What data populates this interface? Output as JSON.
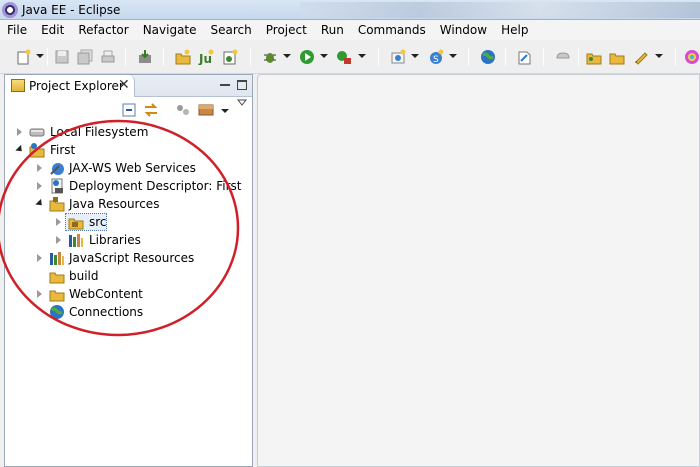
{
  "window": {
    "title": "Java EE - Eclipse"
  },
  "menubar": [
    "File",
    "Edit",
    "Refactor",
    "Navigate",
    "Search",
    "Project",
    "Run",
    "Commands",
    "Window",
    "Help"
  ],
  "toolbar": {
    "icons": [
      "new-icon",
      "save-icon",
      "save-all-icon",
      "print-icon",
      "import-icon",
      "new-project-icon",
      "new-junit-icon",
      "new-class-icon",
      "debug-icon",
      "run-icon",
      "run-server-icon",
      "new-web-icon",
      "new-service-icon",
      "globe-icon",
      "search-file-icon",
      "open-task-icon",
      "open-folder-icon",
      "open-type-icon",
      "pen-icon",
      "perspective-icon"
    ]
  },
  "panel": {
    "tab_label": "Project Explorer",
    "close_glyph": "✕"
  },
  "tree": [
    {
      "label": "Local Filesystem",
      "depth": 0,
      "state": "closed",
      "icon": "drive-icon"
    },
    {
      "label": "First",
      "depth": 0,
      "state": "open",
      "icon": "web-project-icon"
    },
    {
      "label": "JAX-WS Web Services",
      "depth": 1,
      "state": "closed",
      "icon": "web-services-icon"
    },
    {
      "label": "Deployment Descriptor: First",
      "depth": 1,
      "state": "closed",
      "icon": "deployment-descriptor-icon"
    },
    {
      "label": "Java Resources",
      "depth": 1,
      "state": "open",
      "icon": "java-resources-icon"
    },
    {
      "label": "src",
      "depth": 2,
      "state": "closed",
      "icon": "source-folder-icon",
      "selected": true
    },
    {
      "label": "Libraries",
      "depth": 2,
      "state": "closed",
      "icon": "libraries-icon"
    },
    {
      "label": "JavaScript Resources",
      "depth": 1,
      "state": "closed",
      "icon": "javascript-resources-icon"
    },
    {
      "label": "build",
      "depth": 1,
      "state": "none",
      "icon": "folder-icon"
    },
    {
      "label": "WebContent",
      "depth": 1,
      "state": "closed",
      "icon": "folder-icon"
    },
    {
      "label": "Connections",
      "depth": 1,
      "state": "none",
      "icon": "connections-icon"
    }
  ],
  "colors": {
    "annotation": "#d0202a",
    "selection": "#e6effa",
    "folder": "#e8b93c"
  }
}
